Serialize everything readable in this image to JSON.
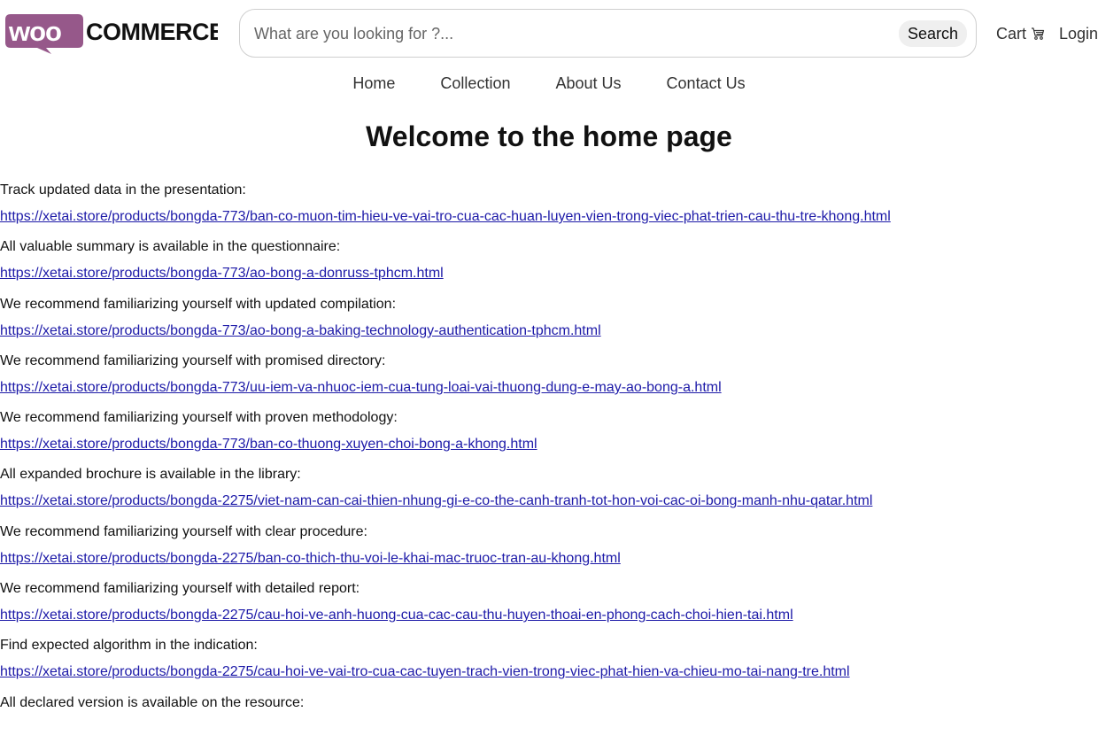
{
  "header": {
    "logo_text": "WOO COMMERCE",
    "search": {
      "placeholder": "What are you looking for ?...",
      "button_label": "Search"
    },
    "cart_label": "Cart",
    "login_label": "Login"
  },
  "nav": {
    "items": [
      {
        "label": "Home"
      },
      {
        "label": "Collection"
      },
      {
        "label": "About Us"
      },
      {
        "label": "Contact Us"
      }
    ]
  },
  "main": {
    "title": "Welcome to the home page",
    "entries": [
      {
        "text": "Track updated data in the presentation:",
        "link": "https://xetai.store/products/bongda-773/ban-co-muon-tim-hieu-ve-vai-tro-cua-cac-huan-luyen-vien-trong-viec-phat-trien-cau-thu-tre-khong.html"
      },
      {
        "text": "All valuable summary is available in the questionnaire:",
        "link": "https://xetai.store/products/bongda-773/ao-bong-a-donruss-tphcm.html"
      },
      {
        "text": "We recommend familiarizing yourself with updated compilation:",
        "link": "https://xetai.store/products/bongda-773/ao-bong-a-baking-technology-authentication-tphcm.html"
      },
      {
        "text": "We recommend familiarizing yourself with promised directory:",
        "link": "https://xetai.store/products/bongda-773/uu-iem-va-nhuoc-iem-cua-tung-loai-vai-thuong-dung-e-may-ao-bong-a.html"
      },
      {
        "text": "We recommend familiarizing yourself with proven methodology:",
        "link": "https://xetai.store/products/bongda-773/ban-co-thuong-xuyen-choi-bong-a-khong.html"
      },
      {
        "text": "All expanded brochure is available in the library:",
        "link": "https://xetai.store/products/bongda-2275/viet-nam-can-cai-thien-nhung-gi-e-co-the-canh-tranh-tot-hon-voi-cac-oi-bong-manh-nhu-qatar.html"
      },
      {
        "text": "We recommend familiarizing yourself with clear procedure:",
        "link": "https://xetai.store/products/bongda-2275/ban-co-thich-thu-voi-le-khai-mac-truoc-tran-au-khong.html"
      },
      {
        "text": "We recommend familiarizing yourself with detailed report:",
        "link": "https://xetai.store/products/bongda-2275/cau-hoi-ve-anh-huong-cua-cac-cau-thu-huyen-thoai-en-phong-cach-choi-hien-tai.html"
      },
      {
        "text": "Find expected algorithm in the indication:",
        "link": "https://xetai.store/products/bongda-2275/cau-hoi-ve-vai-tro-cua-cac-tuyen-trach-vien-trong-viec-phat-hien-va-chieu-mo-tai-nang-tre.html"
      },
      {
        "text": "All declared version is available on the resource:",
        "link": ""
      }
    ]
  },
  "colors": {
    "logo_purple": "#96588a",
    "link": "#1d1aa8"
  }
}
